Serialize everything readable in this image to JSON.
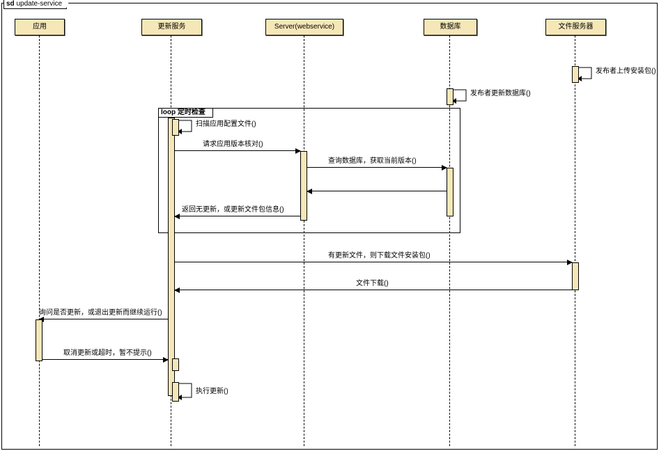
{
  "diagram": {
    "type": "uml-sequence",
    "frame_kind": "sd",
    "frame_name": "update-service",
    "participants": [
      {
        "id": "app",
        "label": "应用"
      },
      {
        "id": "update",
        "label": "更新服务"
      },
      {
        "id": "server",
        "label": "Server(webservice)"
      },
      {
        "id": "db",
        "label": "数据库"
      },
      {
        "id": "file",
        "label": "文件服务器"
      }
    ],
    "messages": {
      "publish_pkg": "发布者上传安装包()",
      "publish_db": "发布者更新数据库()",
      "loop_kind": "loop",
      "loop_label": "定时检查",
      "scan_config": "扫描应用配置文件()",
      "req_version": "请求应用版本核对()",
      "query_db": "查询数据库，获取当前版本()",
      "return_info": "返回无更新，或更新文件包信息()",
      "download_req": "有更新文件，则下载文件安装包()",
      "download_done": "文件下载()",
      "ask_user": "询问是否更新，或退出更新而继续运行()",
      "cancel_opt": "取消更新或超时，暂不提示()",
      "do_update": "执行更新()"
    }
  }
}
